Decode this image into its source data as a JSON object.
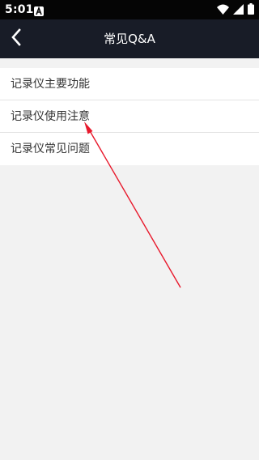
{
  "status_bar": {
    "time": "5:01",
    "icons": [
      "notification-a-icon",
      "wifi-icon",
      "cellular-signal-icon",
      "battery-icon"
    ]
  },
  "header": {
    "title": "常见Q&A",
    "back_icon": "chevron-left-icon"
  },
  "menu": {
    "items": [
      {
        "label": "记录仪主要功能"
      },
      {
        "label": "记录仪使用注意"
      },
      {
        "label": "记录仪常见问题"
      }
    ]
  },
  "colors": {
    "status_bar_bg": "#050505",
    "header_bg": "#181c27",
    "page_bg": "#f2f2f2",
    "list_bg": "#ffffff",
    "annotation_arrow": "#e8192c"
  }
}
